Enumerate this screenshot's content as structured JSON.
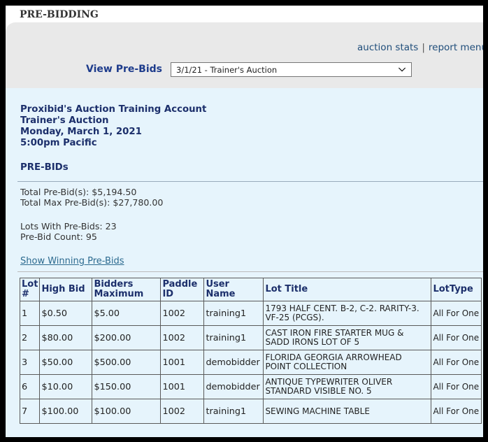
{
  "page": {
    "title": "PRE-BIDDING"
  },
  "header": {
    "links": [
      "auction stats",
      "report menu"
    ],
    "link_separator": "|",
    "view_label": "View Pre-Bids",
    "auction_select_value": "3/1/21 - Trainer's Auction"
  },
  "auction": {
    "account": "Proxibid's Auction Training Account",
    "name": "Trainer's Auction",
    "date": "Monday, March 1, 2021",
    "time": "5:00pm Pacific"
  },
  "summary": {
    "section_title": "PRE-BIDs",
    "total_pre_bids": "Total Pre-Bid(s): $5,194.50",
    "total_max_pre_bids": "Total Max Pre-Bid(s): $27,780.00",
    "lots_with_pre_bids": "Lots With Pre-Bids: 23",
    "pre_bid_count": "Pre-Bid Count: 95",
    "show_winning_link": "Show Winning Pre-Bids"
  },
  "table": {
    "columns": [
      "Lot #",
      "High Bid",
      "Bidders Maximum",
      "Paddle ID",
      "User Name",
      "Lot Title",
      "LotType"
    ],
    "rows": [
      [
        "1",
        "$0.50",
        "$5.00",
        "1002",
        "training1",
        "1793 HALF CENT. B-2, C-2. RARITY-3. VF-25 (PCGS).",
        "All For One"
      ],
      [
        "2",
        "$80.00",
        "$200.00",
        "1002",
        "training1",
        "CAST IRON FIRE STARTER MUG & SADD IRONS LOT OF 5",
        "All For One"
      ],
      [
        "3",
        "$50.00",
        "$500.00",
        "1001",
        "demobidder",
        "FLORIDA GEORGIA ARROWHEAD POINT COLLECTION",
        "All For One"
      ],
      [
        "6",
        "$10.00",
        "$150.00",
        "1001",
        "demobidder",
        "ANTIQUE TYPEWRITER OLIVER STANDARD VISIBLE NO. 5",
        "All For One"
      ],
      [
        "7",
        "$100.00",
        "$100.00",
        "1002",
        "training1",
        "SEWING MACHINE TABLE",
        "All For One"
      ]
    ]
  }
}
